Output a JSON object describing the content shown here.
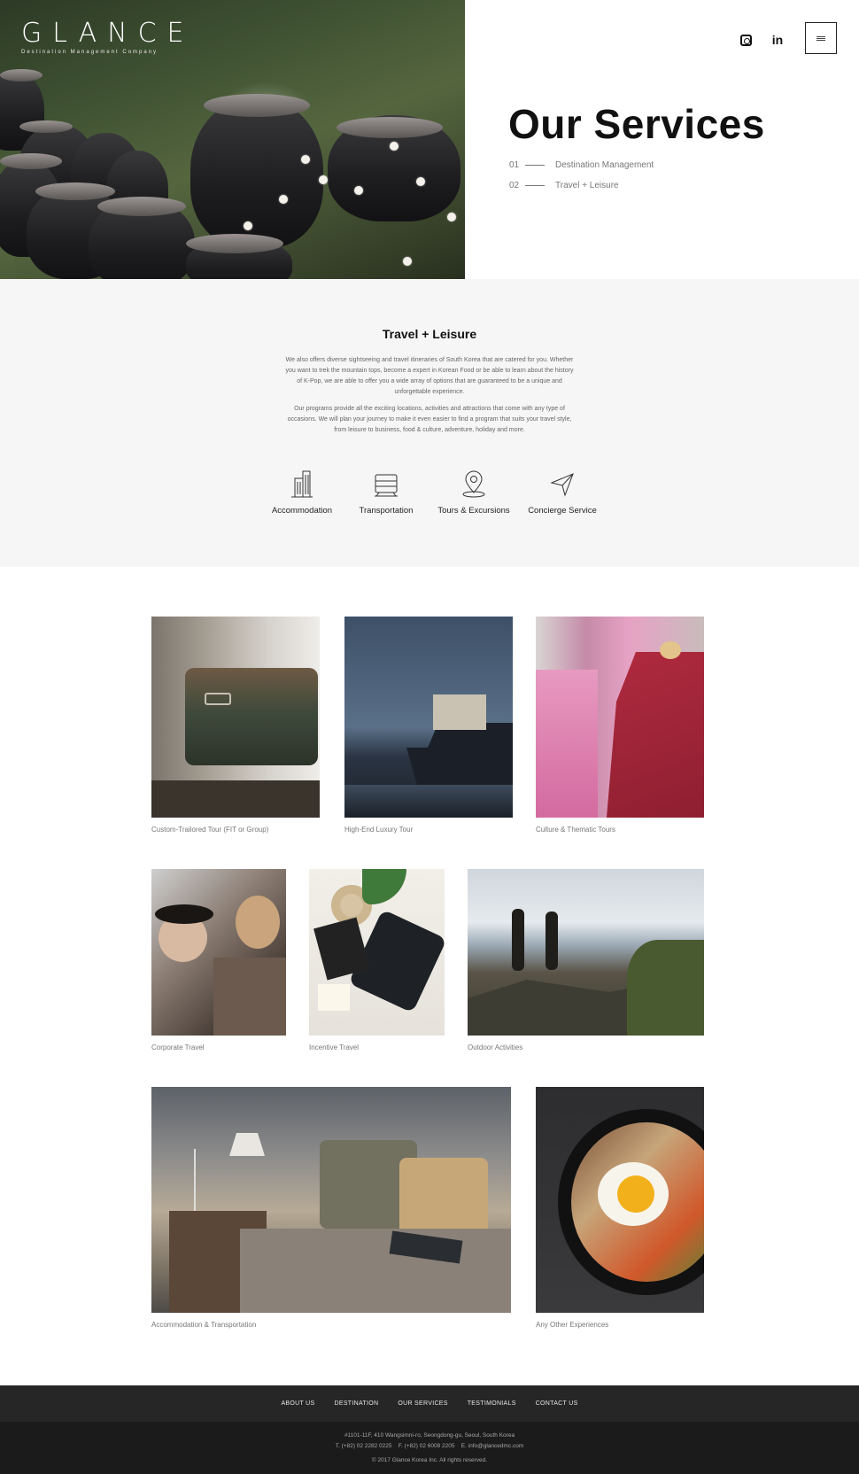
{
  "brand": {
    "name": "GLANCE",
    "tagline": "Destination Management Company"
  },
  "header": {
    "social": [
      "instagram-icon",
      "linkedin-icon"
    ],
    "linkedin_glyph": "in",
    "menu": "menu-icon"
  },
  "hero": {
    "title": "Our Services",
    "links": [
      {
        "num": "01",
        "label": "Destination Management"
      },
      {
        "num": "02",
        "label": "Travel + Leisure"
      }
    ]
  },
  "leisure": {
    "title": "Travel + Leisure",
    "para1": "We also offers diverse sightseeing and travel itineraries of South Korea that are catered for you. Whether you want to trek the mountain tops, become a expert in Korean Food or be able to learn about the history of K-Pop, we are able to offer you a wide array of options that are guaranteed to be a unique and unforgettable experience.",
    "para2": "Our programs provide all the exciting locations, activities and attractions that come with any type of occasions. We will plan your journey to make it even easier to find a program that suits your travel style, from leisure to business, food & culture, adventure, holiday and more.",
    "features": [
      {
        "label": "Accommodation",
        "icon": "building-icon"
      },
      {
        "label": "Transportation",
        "icon": "train-icon"
      },
      {
        "label": "Tours & Excursions",
        "icon": "map-pin-icon"
      },
      {
        "label": "Concierge Service",
        "icon": "paper-plane-icon"
      }
    ]
  },
  "gallery": [
    {
      "caption": "Custom-Trailored Tour (FIT or Group)"
    },
    {
      "caption": "High-End Luxury Tour"
    },
    {
      "caption": "Culture & Thematic Tours"
    },
    {
      "caption": "Corporate Travel"
    },
    {
      "caption": "Incentive Travel"
    },
    {
      "caption": "Outdoor Activities"
    },
    {
      "caption": "Accommodation & Transportation"
    },
    {
      "caption": "Any Other Experiences"
    }
  ],
  "footer": {
    "nav": [
      "ABOUT US",
      "DESTINATION",
      "OUR SERVICES",
      "TESTIMONIALS",
      "CONTACT US"
    ],
    "address": "#1101-11F, 410 Wangsimni-ro, Seongdong-gu, Seoul, South Korea",
    "contact": "T. (+82) 02 2282 0225    F. (+82) 02 6008 2205    E. info@glancedmc.com",
    "copyright": "© 2017 Glance Korea Inc. All rights reserved."
  }
}
